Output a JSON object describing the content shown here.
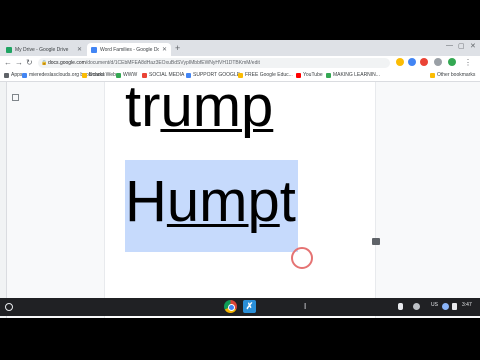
{
  "tabs": [
    {
      "title": "My Drive - Google Drive",
      "color": "#1fa463",
      "active": false
    },
    {
      "title": "Word Families - Google Docs",
      "color": "#4285f4",
      "active": true
    }
  ],
  "toolbar": {
    "url_host": "docs.google.com",
    "url_path": "/document/d/1CEbMFEA8dHaz3EOxuBdSVypIMbbfEWNyHVH1DTBKmM/edit",
    "back_icon": "back-arrow-icon",
    "forward_icon": "forward-arrow-icon",
    "reload_icon": "reload-icon"
  },
  "bookmarks": [
    {
      "label": "Apps",
      "color": "#5f6368"
    },
    {
      "label": "mieredeslasclouds.org bookmarks",
      "color": "#4285f4"
    },
    {
      "label": "School Web",
      "color": "#fbbc04"
    },
    {
      "label": "WWW",
      "color": "#34a853"
    },
    {
      "label": "SOCIAL MEDIA",
      "color": "#ea4335"
    },
    {
      "label": "SUPPORT GOOGLE",
      "color": "#4285f4"
    },
    {
      "label": "FREE Google Educ...",
      "color": "#fbbc04"
    },
    {
      "label": "YouTube",
      "color": "#ff0000"
    },
    {
      "label": "MAKING LEARNIN...",
      "color": "#34a853"
    },
    {
      "label": "Other bookmarks",
      "color": "#fbbc04"
    }
  ],
  "document": {
    "word1_plain": "tr",
    "word1_underlined": "ump",
    "word2_plain": "H",
    "word2_underlined": "ump",
    "word2_tail": "t"
  },
  "shelf": {
    "time": "3:47",
    "locale": "US",
    "selection_color": "#c6dafc"
  }
}
